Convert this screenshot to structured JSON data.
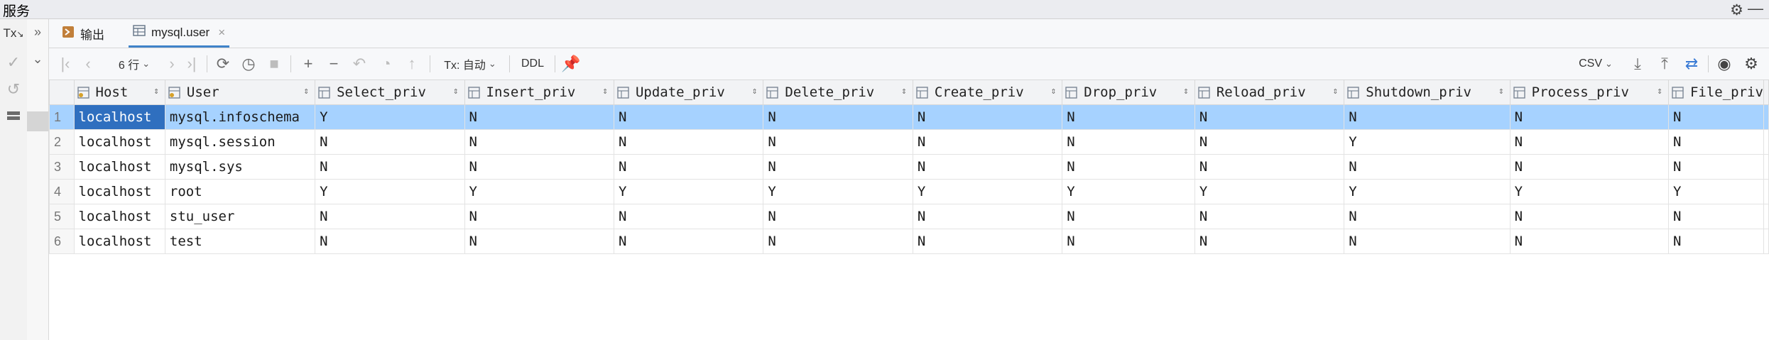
{
  "window": {
    "title": "服务"
  },
  "left_bar": {
    "tx_label": "Tx"
  },
  "tabs": [
    {
      "label": "输出",
      "icon": "output-icon",
      "active": false
    },
    {
      "label": "mysql.user",
      "icon": "table-icon",
      "active": true
    }
  ],
  "toolbar": {
    "row_count": "6 行",
    "tx_mode": "Tx: 自动",
    "ddl": "DDL",
    "export_format": "CSV"
  },
  "table": {
    "columns": [
      "Host",
      "User",
      "Select_priv",
      "Insert_priv",
      "Update_priv",
      "Delete_priv",
      "Create_priv",
      "Drop_priv",
      "Reload_priv",
      "Shutdown_priv",
      "Process_priv",
      "File_priv"
    ],
    "rows": [
      {
        "num": "1",
        "cells": [
          "localhost",
          "mysql.infoschema",
          "Y",
          "N",
          "N",
          "N",
          "N",
          "N",
          "N",
          "N",
          "N",
          "N"
        ]
      },
      {
        "num": "2",
        "cells": [
          "localhost",
          "mysql.session",
          "N",
          "N",
          "N",
          "N",
          "N",
          "N",
          "N",
          "Y",
          "N",
          "N"
        ]
      },
      {
        "num": "3",
        "cells": [
          "localhost",
          "mysql.sys",
          "N",
          "N",
          "N",
          "N",
          "N",
          "N",
          "N",
          "N",
          "N",
          "N"
        ]
      },
      {
        "num": "4",
        "cells": [
          "localhost",
          "root",
          "Y",
          "Y",
          "Y",
          "Y",
          "Y",
          "Y",
          "Y",
          "Y",
          "Y",
          "Y"
        ]
      },
      {
        "num": "5",
        "cells": [
          "localhost",
          "stu_user",
          "N",
          "N",
          "N",
          "N",
          "N",
          "N",
          "N",
          "N",
          "N",
          "N"
        ]
      },
      {
        "num": "6",
        "cells": [
          "localhost",
          "test",
          "N",
          "N",
          "N",
          "N",
          "N",
          "N",
          "N",
          "N",
          "N",
          "N"
        ]
      }
    ],
    "selected_row": 0
  },
  "colors": {
    "selected_row": "#a6d2ff",
    "selected_cell": "#2f6fbf",
    "accent": "#4083c9"
  }
}
